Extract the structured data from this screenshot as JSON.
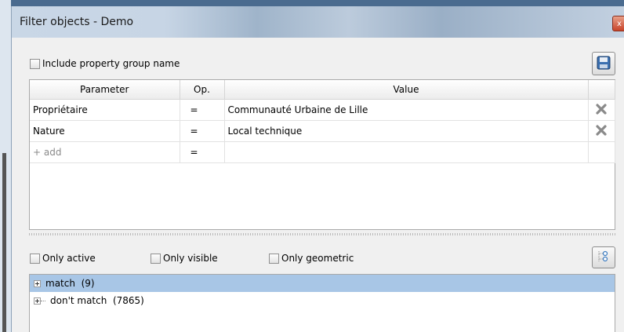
{
  "window": {
    "title": "Filter objects - Demo",
    "close_glyph": "x"
  },
  "options": {
    "include_group_label": "Include property group name"
  },
  "grid": {
    "headers": [
      "Parameter",
      "Op.",
      "Value"
    ],
    "rows": [
      {
        "parameter": "Propriétaire",
        "op": "=",
        "value": "Communauté Urbaine de Lille"
      },
      {
        "parameter": "Nature",
        "op": "=",
        "value": "Local technique"
      }
    ],
    "add_row": {
      "parameter": "+ add",
      "op": "="
    }
  },
  "filters": {
    "only_active": "Only active",
    "only_visible": "Only visible",
    "only_geometric": "Only geometric"
  },
  "tree": [
    {
      "label": "match  (9)",
      "selected": true
    },
    {
      "label": "don't match  (7865)",
      "selected": false
    }
  ],
  "icons": {
    "save": "save-icon",
    "delete": "delete-x-icon",
    "filter_options": "filter-options-icon"
  },
  "colors": {
    "selection": "#a8c6e6",
    "titlebar": "#c9d7e6"
  }
}
